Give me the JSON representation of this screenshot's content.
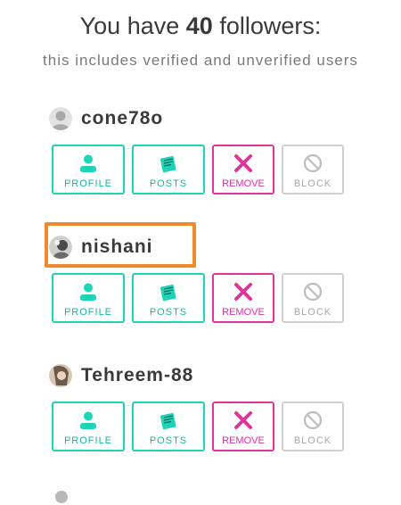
{
  "header": {
    "title_prefix": "You have ",
    "follower_count": "40",
    "title_suffix": " followers:",
    "subtitle": "this includes verified and unverified users"
  },
  "followers": [
    {
      "username": "cone78o",
      "avatar": "default-avatar"
    },
    {
      "username": "nishani",
      "avatar": "photo-avatar"
    },
    {
      "username": "Tehreem-88",
      "avatar": "photo-avatar"
    }
  ],
  "actions": {
    "profile_label": "PROFILE",
    "posts_label": "POSTS",
    "remove_label": "REMOVE",
    "block_label": "BLOCK"
  },
  "colors": {
    "accent_teal": "#1ed4b6",
    "remove_pink": "#e0339b",
    "disabled_gray": "#cfcfcf",
    "highlight_orange": "#f08a2c"
  },
  "icons": {
    "profile": "person-icon",
    "posts": "notes-icon",
    "remove": "x-icon",
    "block": "block-icon"
  }
}
